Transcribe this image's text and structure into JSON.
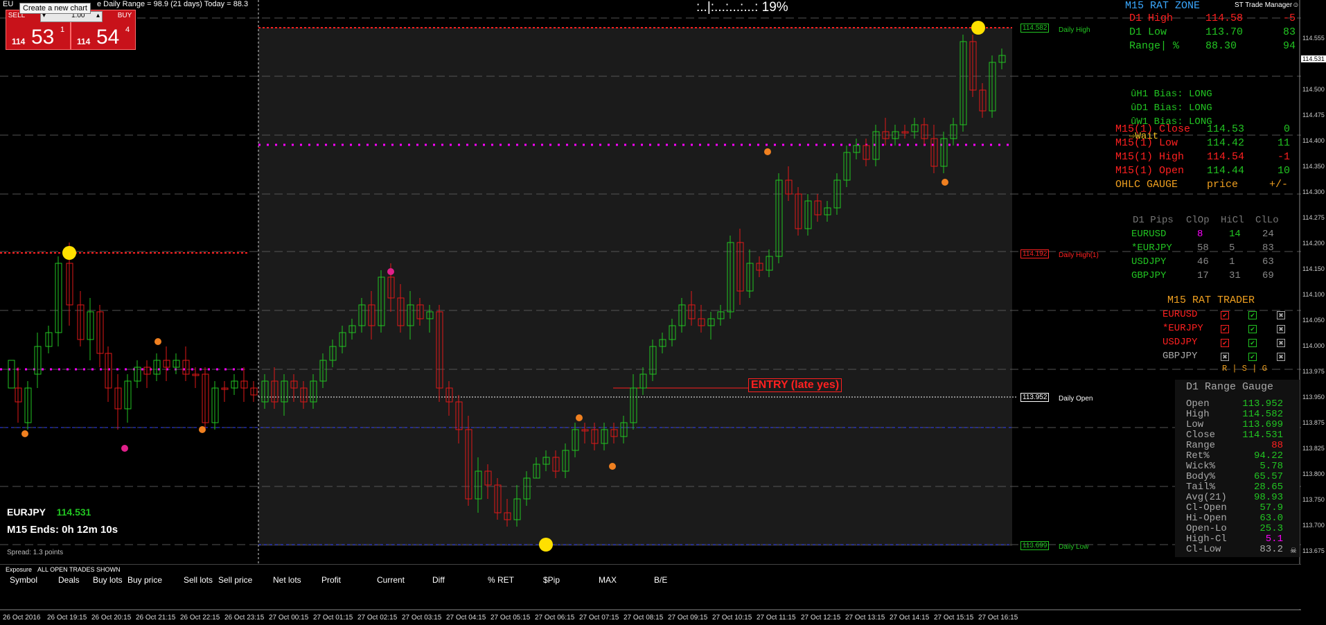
{
  "header": {
    "symbol_prefix": "EU",
    "title_text": "e Daily Range = 98.9 (21 days)   Today = 88.3",
    "center_timer": ":..|:...:...:...:  19%",
    "st_trade_manager": "ST Trade Manager",
    "tooltip": "Create a new chart"
  },
  "trade_panel": {
    "sell_label": "SELL",
    "buy_label": "BUY",
    "lot_value": "1.00",
    "sell_price_prefix": "114",
    "sell_price_big": "53",
    "sell_price_small": "1",
    "buy_price_prefix": "114",
    "buy_price_big": "54",
    "buy_price_small": "4"
  },
  "rat_zone": {
    "title": "M15 RAT ZONE",
    "rows": [
      {
        "label": "D1 High",
        "value": "114.58",
        "diff": "-5"
      },
      {
        "label": "D1 Low",
        "value": "113.70",
        "diff": "83"
      },
      {
        "label": "Range| %",
        "value": "88.30",
        "diff": "94"
      }
    ],
    "bias": [
      "ûH1 Bias: LONG",
      "ûD1 Bias: LONG",
      "ûW1 Bias: LONG"
    ],
    "wait": "⇨Wait"
  },
  "ohlc": {
    "rows": [
      {
        "label": "M15(1) Close",
        "value": "114.53",
        "diff": "0"
      },
      {
        "label": "M15(1) Low",
        "value": "114.42",
        "diff": "11"
      },
      {
        "label": "M15(1) High",
        "value": "114.54",
        "diff": "-1"
      },
      {
        "label": "M15(1) Open",
        "value": "114.44",
        "diff": "10"
      }
    ],
    "gauge_label": "OHLC GAUGE",
    "gauge_price": "price",
    "gauge_pm": "+/-"
  },
  "d1_pips": {
    "headers": [
      "D1 Pips",
      "ClOp",
      "HiCl",
      "ClLo"
    ],
    "rows": [
      {
        "sym": "EURUSD",
        "a": "8",
        "b": "14",
        "c": "24"
      },
      {
        "sym": "*EURJPY",
        "a": "58",
        "b": "5",
        "c": "83"
      },
      {
        "sym": "USDJPY",
        "a": "46",
        "b": "1",
        "c": "63"
      },
      {
        "sym": "GBPJPY",
        "a": "17",
        "b": "31",
        "c": "69"
      }
    ]
  },
  "rat_trader": {
    "title": "M15 RAT TRADER",
    "rows": [
      "EURUSD",
      "*EURJPY",
      "USDJPY",
      "GBPJPY"
    ],
    "footer": "R | S | G"
  },
  "range_gauge": {
    "title": "D1 Range Gauge",
    "rows": [
      {
        "label": "Open",
        "value": "113.952"
      },
      {
        "label": "High",
        "value": "114.582"
      },
      {
        "label": "Low",
        "value": "113.699"
      },
      {
        "label": "Close",
        "value": "114.531"
      },
      {
        "label": "Range",
        "value": "88"
      },
      {
        "label": "Ret%",
        "value": "94.22"
      },
      {
        "label": "Wick%",
        "value": "5.78"
      },
      {
        "label": "Body%",
        "value": "65.57"
      },
      {
        "label": "Tail%",
        "value": "28.65"
      },
      {
        "label": "Avg(21)",
        "value": "98.93"
      },
      {
        "label": "Cl-Open",
        "value": "57.9"
      },
      {
        "label": "Hi-Open",
        "value": "63.0"
      },
      {
        "label": "Open-Lo",
        "value": "25.3"
      },
      {
        "label": "High-Cl",
        "value": "5.1"
      },
      {
        "label": "Cl-Low",
        "value": "83.2"
      }
    ]
  },
  "chart_labels": {
    "entry": "ENTRY (late yes)",
    "daily_high": "Daily High",
    "daily_high_1": "Daily High(1)",
    "daily_open": "Daily Open",
    "daily_low": "Daily Low",
    "daily_high_price": "114.582",
    "daily_high1_price": "114.192",
    "daily_open_price": "113.952",
    "daily_low_price": "113.699",
    "symbol": "EURJPY",
    "symbol_price": "114.531",
    "m15_ends": "M15 Ends: 0h 12m 10s",
    "spread": "Spread: 1.3 points"
  },
  "y_axis": [
    "114.555",
    "114.531",
    "114.500",
    "114.475",
    "114.400",
    "114.350",
    "114.300",
    "114.275",
    "114.200",
    "114.150",
    "114.100",
    "114.050",
    "114.000",
    "113.975",
    "113.950",
    "113.875",
    "113.825",
    "113.800",
    "113.750",
    "113.700",
    "113.675"
  ],
  "x_axis": [
    "26 Oct 2016",
    "26 Oct 19:15",
    "26 Oct 20:15",
    "26 Oct 21:15",
    "26 Oct 22:15",
    "26 Oct 23:15",
    "27 Oct 00:15",
    "27 Oct 01:15",
    "27 Oct 02:15",
    "27 Oct 03:15",
    "27 Oct 04:15",
    "27 Oct 05:15",
    "27 Oct 06:15",
    "27 Oct 07:15",
    "27 Oct 08:15",
    "27 Oct 09:15",
    "27 Oct 10:15",
    "27 Oct 11:15",
    "27 Oct 12:15",
    "27 Oct 13:15",
    "27 Oct 14:15",
    "27 Oct 15:15",
    "27 Oct 16:15"
  ],
  "exposure": {
    "tab": "Exposure",
    "subtitle": "ALL OPEN TRADES SHOWN",
    "columns": [
      "Symbol",
      "Deals",
      "Buy lots",
      "Buy price",
      "Sell lots",
      "Sell price",
      "Net lots",
      "Profit",
      "Current",
      "Diff",
      "% RET",
      "$Pip",
      "MAX",
      "B/E"
    ]
  },
  "colors": {
    "bull": "#22c522",
    "bear": "#e01818",
    "magenta": "#ff00ff",
    "red": "#ff2020",
    "blue": "#3040ff"
  }
}
